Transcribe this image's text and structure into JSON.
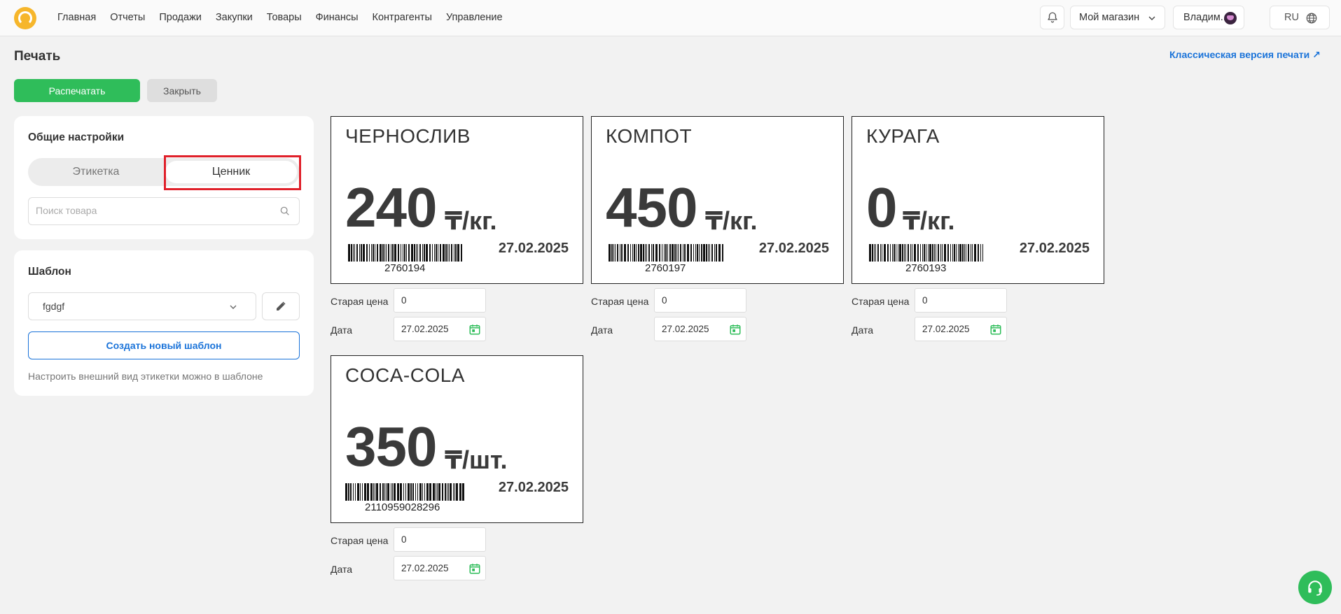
{
  "topbar": {
    "nav": [
      "Главная",
      "Отчеты",
      "Продажи",
      "Закупки",
      "Товары",
      "Финансы",
      "Контрагенты",
      "Управление"
    ],
    "shop_label": "Мой магазин",
    "user_label": "Владим...",
    "lang_label": "RU"
  },
  "page": {
    "title": "Печать",
    "classic_link": "Классическая версия печати ↗",
    "print_button": "Распечатать",
    "close_button": "Закрыть"
  },
  "settings": {
    "title": "Общие настройки",
    "seg_label": "Этикетка",
    "seg_price_tag": "Ценник",
    "search_placeholder": "Поиск товара"
  },
  "template": {
    "title": "Шаблон",
    "selected": "fgdgf",
    "create_button": "Создать новый шаблон",
    "hint": "Настроить внешний вид этикетки можно в шаблоне"
  },
  "field_labels": {
    "old_price": "Старая цена",
    "date": "Дата"
  },
  "tags": [
    {
      "name": "ЧЕРНОСЛИВ",
      "price": "240",
      "unit": "₸/кг.",
      "date": "27.02.2025",
      "code": "2760194",
      "old_price": "0",
      "date_value": "27.02.2025"
    },
    {
      "name": "КОМПОТ",
      "price": "450",
      "unit": "₸/кг.",
      "date": "27.02.2025",
      "code": "2760197",
      "old_price": "0",
      "date_value": "27.02.2025"
    },
    {
      "name": "КУРАГА",
      "price": "0",
      "unit": "₸/кг.",
      "date": "27.02.2025",
      "code": "2760193",
      "old_price": "0",
      "date_value": "27.02.2025"
    },
    {
      "name": "COCA-COLA",
      "price": "350",
      "unit": "₸/шт.",
      "date": "27.02.2025",
      "code": "2110959028296",
      "old_price": "0",
      "date_value": "27.02.2025"
    }
  ],
  "colors": {
    "accent_green": "#2fbd5a",
    "link_blue": "#1a73d9",
    "highlight_red": "#e0202a",
    "logo_yellow": "#f6b62b"
  }
}
